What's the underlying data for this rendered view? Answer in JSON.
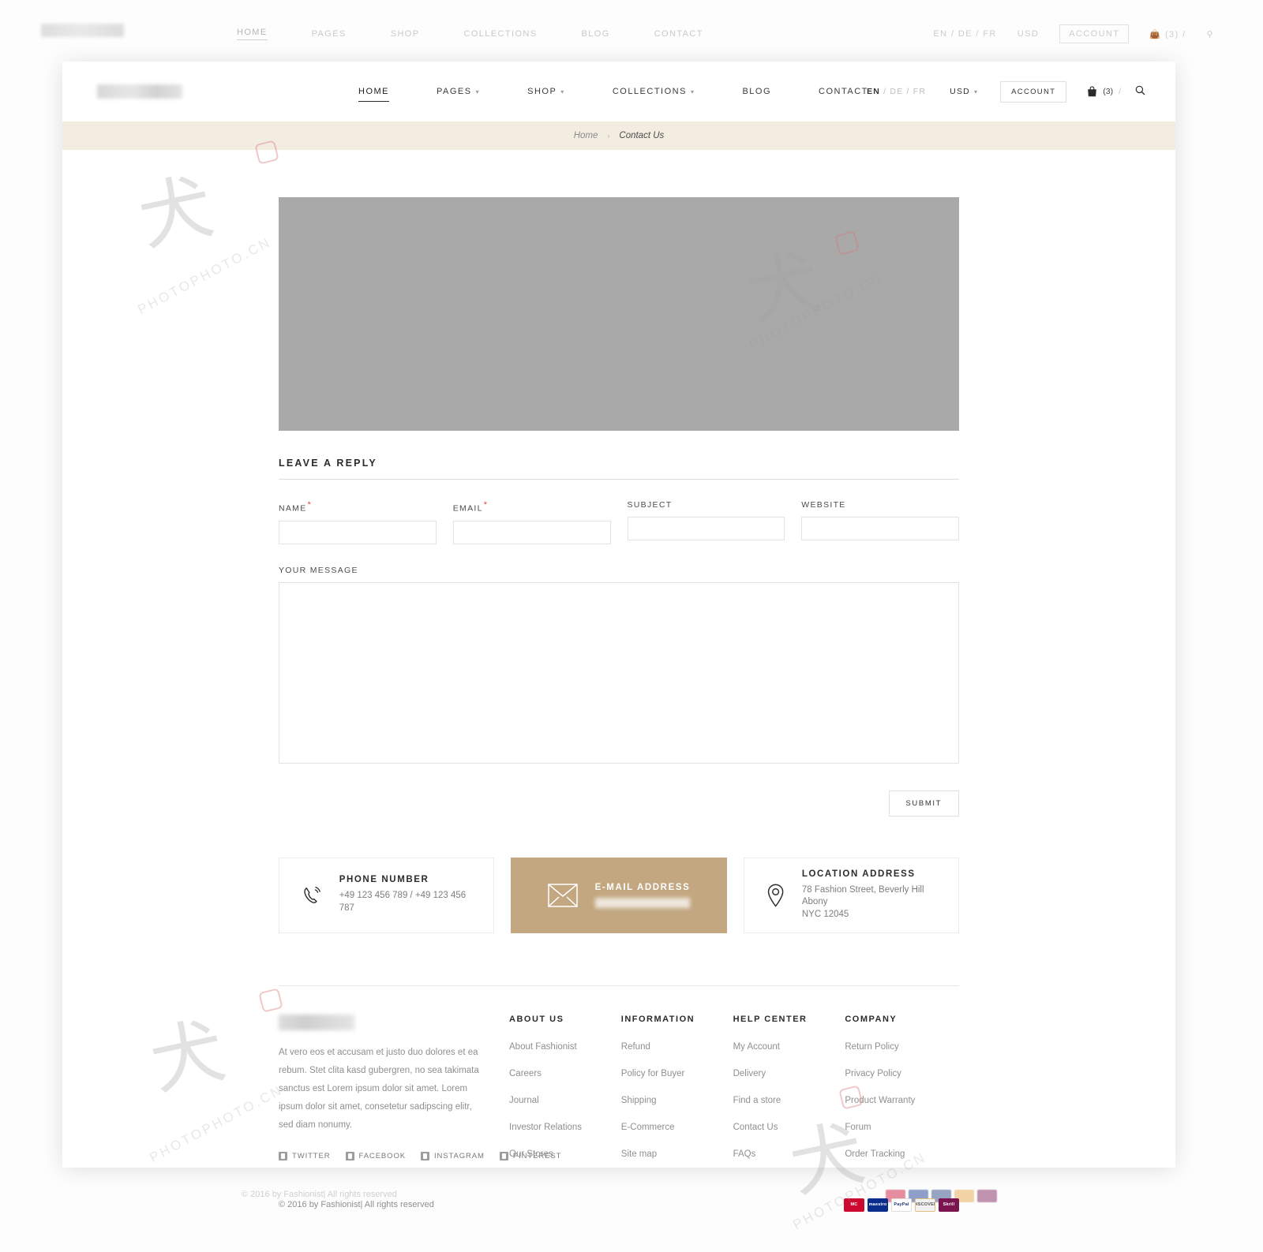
{
  "header": {
    "nav": [
      {
        "label": "HOME",
        "caret": false,
        "active": true
      },
      {
        "label": "PAGES",
        "caret": true,
        "active": false
      },
      {
        "label": "SHOP",
        "caret": true,
        "active": false
      },
      {
        "label": "COLLECTIONS",
        "caret": true,
        "active": false
      },
      {
        "label": "BLOG",
        "caret": false,
        "active": false
      },
      {
        "label": "CONTACT",
        "caret": false,
        "active": false
      }
    ],
    "lang_active": "EN",
    "lang_rest": " / DE / FR",
    "currency": "USD",
    "account_label": "ACCOUNT",
    "cart_count": "(3)",
    "cart_sep": "/"
  },
  "breadcrumb": {
    "home": "Home",
    "separator": "›",
    "current": "Contact Us"
  },
  "form": {
    "title": "LEAVE A REPLY",
    "fields": [
      {
        "label": "NAME",
        "required": true,
        "value": "",
        "placeholder": ""
      },
      {
        "label": "EMAIL",
        "required": true,
        "value": "",
        "placeholder": ""
      },
      {
        "label": "SUBJECT",
        "required": false,
        "value": "",
        "placeholder": ""
      },
      {
        "label": "WEBSITE",
        "required": false,
        "value": "",
        "placeholder": ""
      }
    ],
    "message_label": "YOUR MESSAGE",
    "message_value": "",
    "submit_label": "SUBMIT"
  },
  "contact_cards": [
    {
      "icon": "phone-icon",
      "title": "PHONE NUMBER",
      "line1": "+49 123 456 789  /  +49 123 456 787",
      "line2": "",
      "accent": false
    },
    {
      "icon": "envelope-icon",
      "title": "E-MAIL ADDRESS",
      "line1": "",
      "line2": "",
      "accent": true
    },
    {
      "icon": "location-pin-icon",
      "title": "LOCATION ADDRESS",
      "line1": "78 Fashion Street, Beverly Hill Abony",
      "line2": "NYC 12045",
      "accent": false
    }
  ],
  "footer": {
    "description": "At vero eos et accusam et justo duo dolores et ea rebum. Stet clita kasd gubergren, no sea takimata sanctus est Lorem ipsum dolor sit amet. Lorem ipsum dolor sit amet, consetetur sadipscing elitr, sed diam nonumy.",
    "socials": [
      {
        "label": "TWITTER",
        "icon": "twitter-icon"
      },
      {
        "label": "FACEBOOK",
        "icon": "facebook-icon"
      },
      {
        "label": "INSTAGRAM",
        "icon": "instagram-icon"
      },
      {
        "label": "PINTEREST",
        "icon": "pinterest-icon"
      }
    ],
    "columns": [
      {
        "heading": "ABOUT US",
        "links": [
          "About Fashionist",
          "Careers",
          "Journal",
          "Investor Relations",
          "Our Stores"
        ]
      },
      {
        "heading": "INFORMATION",
        "links": [
          "Refund",
          "Policy for Buyer",
          "Shipping",
          "E-Commerce",
          "Site map"
        ]
      },
      {
        "heading": "HELP CENTER",
        "links": [
          "My Account",
          "Delivery",
          "Find a store",
          "Contact Us",
          "FAQs"
        ]
      },
      {
        "heading": "COMPANY",
        "links": [
          "Return Policy",
          "Privacy Policy",
          "Product Warranty",
          "Forum",
          "Order Tracking"
        ]
      }
    ],
    "copyright": "© 2016 by Fashionist| All rights reserved",
    "payments": [
      {
        "name": "mastercard",
        "label": "MC",
        "color": "#cc0a2f"
      },
      {
        "name": "maestro",
        "label": "maestro",
        "color": "#0a2d8c"
      },
      {
        "name": "paypal",
        "label": "PayPal",
        "color": "#ffffff"
      },
      {
        "name": "discover",
        "label": "DISCOVER",
        "color": "#f2f2f2"
      },
      {
        "name": "skrill",
        "label": "Skrill",
        "color": "#7a1550"
      }
    ]
  },
  "colors": {
    "accent": "#c2a780",
    "breadcrumb_bg": "#f3ece1",
    "required": "#e0464a",
    "map_placeholder": "#a9a9a9"
  }
}
